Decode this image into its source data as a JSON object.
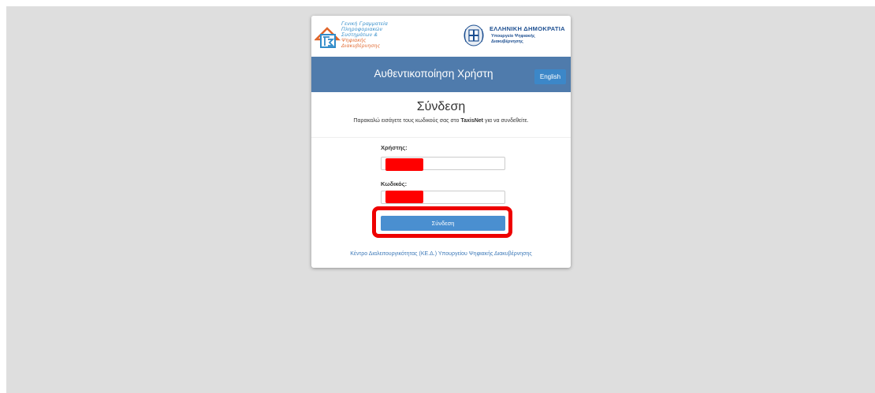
{
  "logos": {
    "gsis": {
      "lines": [
        "Γενική Γραμματεία",
        "Πληροφοριακών",
        "Συστημάτων &",
        "Ψηφιακής Διακυβέρνησης"
      ]
    },
    "hellenic_republic": {
      "title": "ΕΛΛΗΝΙΚΗ ΔΗΜΟΚΡΑΤΙΑ",
      "subtitle_lines": [
        "Υπουργείο Ψηφιακής",
        "Διακυβέρνησης"
      ]
    }
  },
  "header": {
    "title": "Αυθεντικοποίηση Χρήστη",
    "language_button": "English"
  },
  "login": {
    "title": "Σύνδεση",
    "instructions_prefix": "Παρακαλώ εισάγετε τους κωδικούς σας στο ",
    "instructions_brand": "TaxisNet",
    "instructions_suffix": " για να συνδεθείτε.",
    "username_label": "Χρήστης:",
    "password_label": "Κωδικός:",
    "submit_label": "Σύνδεση"
  },
  "footer": {
    "link": "Κέντρο Διαλειτουργικότητας (ΚΕ.Δ.) Υπουργείου Ψηφιακής Διακυβέρνησης"
  },
  "colors": {
    "header_bar": "#4f7bac",
    "button": "#4a8fd0",
    "highlight": "#ee0000",
    "redaction": "#ff0000"
  }
}
